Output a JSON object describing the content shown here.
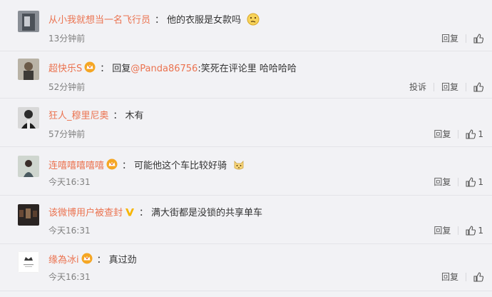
{
  "comments": [
    {
      "name": "从小我就想当一名飞行员",
      "badge": "",
      "reply_prefix": "",
      "mention": "",
      "text": "他的衣服是女款吗",
      "emoji": "confused-face-emoji",
      "time": "13分钟前",
      "report": "",
      "reply": "回复",
      "likes": ""
    },
    {
      "name": "超快乐S",
      "badge": "crown-badge",
      "reply_prefix": "回复",
      "mention": "@Panda86756",
      "text": ":笑死在评论里 哈哈哈哈",
      "emoji": "",
      "time": "52分钟前",
      "report": "投诉",
      "reply": "回复",
      "likes": ""
    },
    {
      "name": "狂人_穆里尼奥",
      "badge": "",
      "reply_prefix": "",
      "mention": "",
      "text": "木有",
      "emoji": "",
      "time": "57分钟前",
      "report": "",
      "reply": "回复",
      "likes": "1"
    },
    {
      "name": "连嘻嘻嘻嘻嘻",
      "badge": "crown-badge",
      "reply_prefix": "",
      "mention": "",
      "text": "可能他这个车比较好骑",
      "emoji": "cat-face-emoji",
      "time": "今天16:31",
      "report": "",
      "reply": "回复",
      "likes": "1"
    },
    {
      "name": "该微博用户被查封",
      "badge": "v-badge",
      "reply_prefix": "",
      "mention": "",
      "text": "满大街都是没锁的共享单车",
      "emoji": "",
      "time": "今天16:31",
      "report": "",
      "reply": "回复",
      "likes": "1"
    },
    {
      "name": "缘為冰i",
      "badge": "crown-badge",
      "reply_prefix": "",
      "mention": "",
      "text": "真过劲",
      "emoji": "",
      "time": "今天16:31",
      "report": "",
      "reply": "回复",
      "likes": ""
    }
  ],
  "colors": {
    "name": "#eb7350",
    "background": "#f2f2f5",
    "badge_crown": "#f5a623",
    "badge_v": "#f7b500"
  },
  "icons": {
    "like": "thumbs-up-icon"
  }
}
